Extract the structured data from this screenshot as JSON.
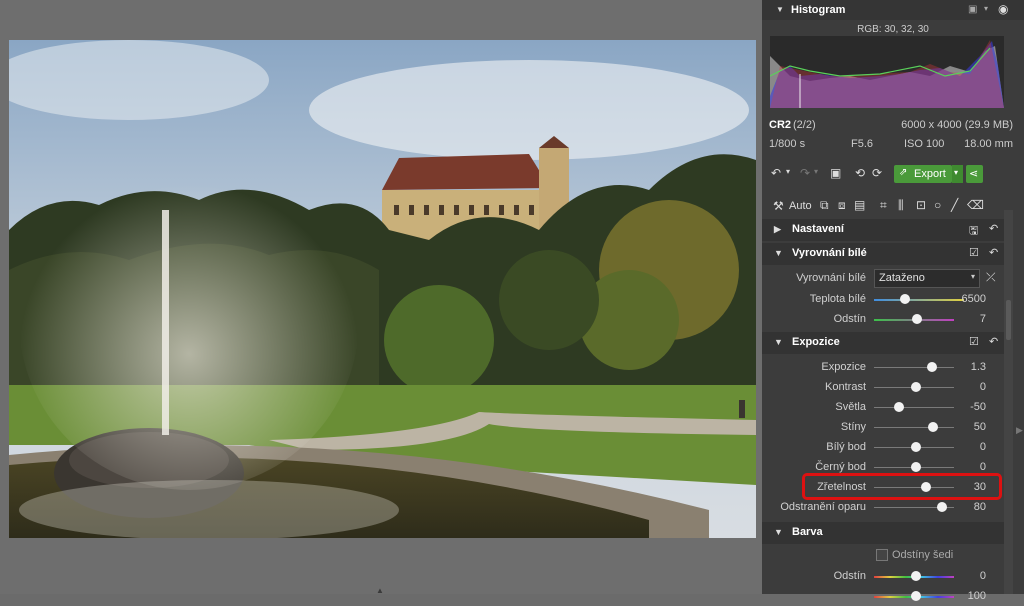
{
  "histogram": {
    "title": "Histogram",
    "rgb_readout": "RGB: 30, 32, 30"
  },
  "exif": {
    "format": "CR2",
    "index": "(2/2)",
    "dimensions": "6000 x 4000 (29.9 MB)",
    "shutter": "1/800 s",
    "aperture": "F5.6",
    "iso": "ISO 100",
    "focal": "18.00 mm"
  },
  "toolbar": {
    "export_label": "Export",
    "auto_label": "Auto"
  },
  "sections": {
    "nastaveni": "Nastavení",
    "vyrovnani_bile": "Vyrovnání bílé",
    "expozice": "Expozice",
    "barva": "Barva"
  },
  "white_balance": {
    "label": "Vyrovnání bílé",
    "selected": "Zataženo",
    "temperature_label": "Teplota bílé",
    "temperature_value": "6500",
    "tint_label": "Odstín",
    "tint_value": "7"
  },
  "exposure_sliders": [
    {
      "label": "Expozice",
      "value": "1.3"
    },
    {
      "label": "Kontrast",
      "value": "0"
    },
    {
      "label": "Světla",
      "value": "-50"
    },
    {
      "label": "Stíny",
      "value": "50"
    },
    {
      "label": "Bílý bod",
      "value": "0"
    },
    {
      "label": "Černý bod",
      "value": "0"
    },
    {
      "label": "Zřetelnost",
      "value": "30"
    },
    {
      "label": "Odstranění oparu",
      "value": "80"
    }
  ],
  "color": {
    "grayscale_label": "Odstíny šedi",
    "hue_label": "Odstín",
    "hue_value": "0",
    "sat_value": "100"
  },
  "colors": {
    "highlight": "#d11111",
    "export_button": "#4a9a3a"
  }
}
